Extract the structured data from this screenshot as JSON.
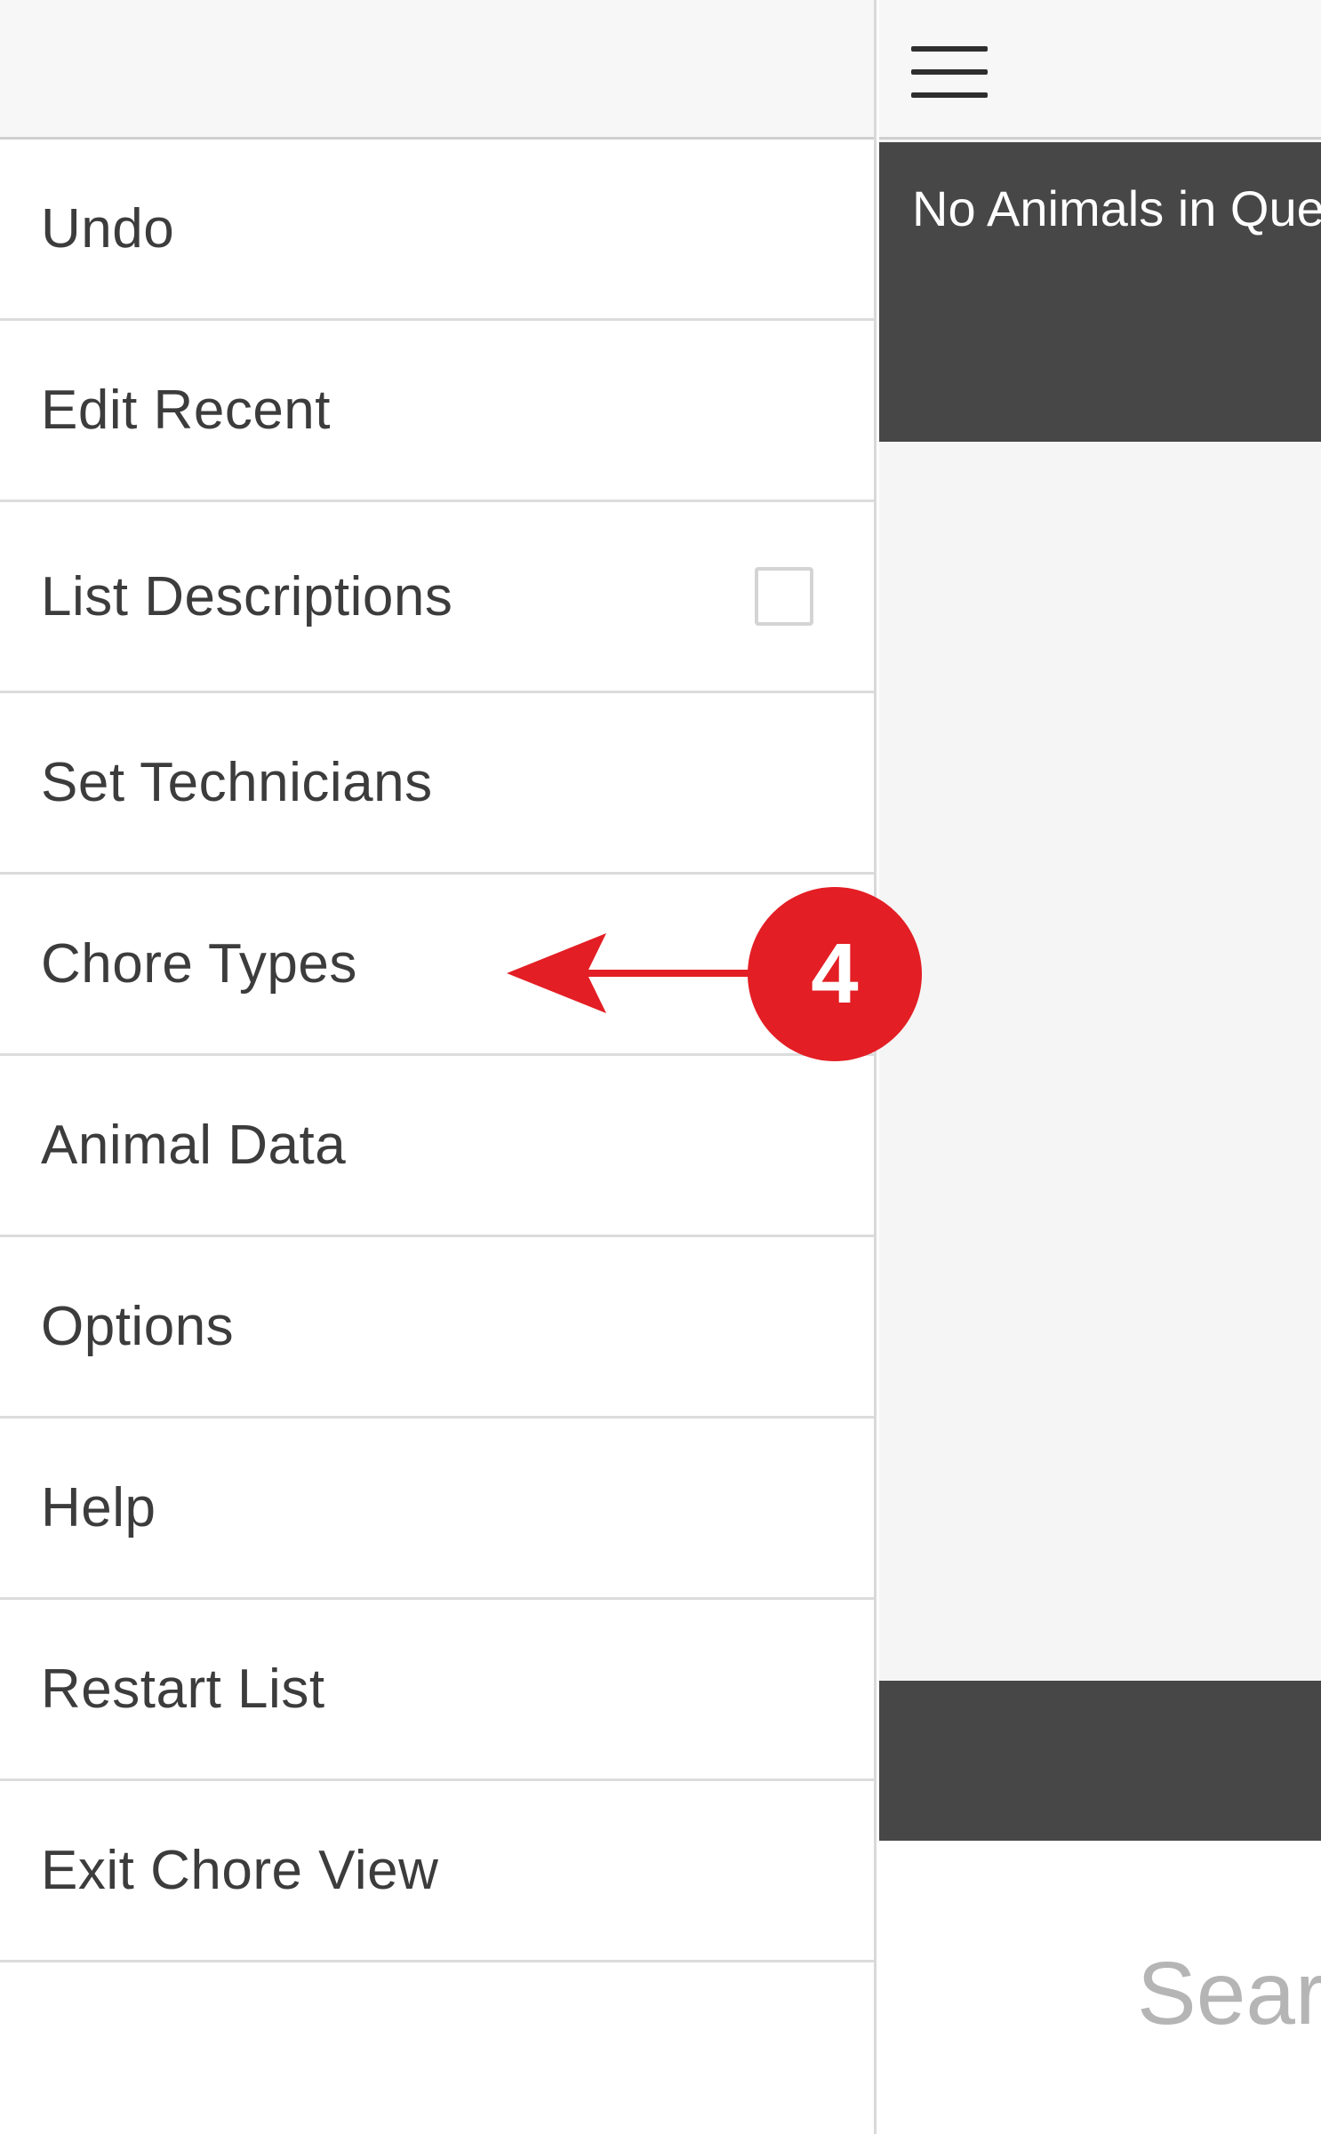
{
  "drawer": {
    "items": [
      {
        "label": "Undo"
      },
      {
        "label": "Edit Recent"
      },
      {
        "label": "List Descriptions",
        "checkbox": false
      },
      {
        "label": "Set Technicians"
      },
      {
        "label": "Chore Types"
      },
      {
        "label": "Animal Data"
      },
      {
        "label": "Options"
      },
      {
        "label": "Help"
      },
      {
        "label": "Restart List"
      },
      {
        "label": "Exit Chore View"
      }
    ]
  },
  "main": {
    "menu_icon": "hamburger-menu-icon",
    "queue_status": "No Animals in Que",
    "search_label": "Searc"
  },
  "annotation": {
    "step_number": "4",
    "color": "#e31e24"
  }
}
